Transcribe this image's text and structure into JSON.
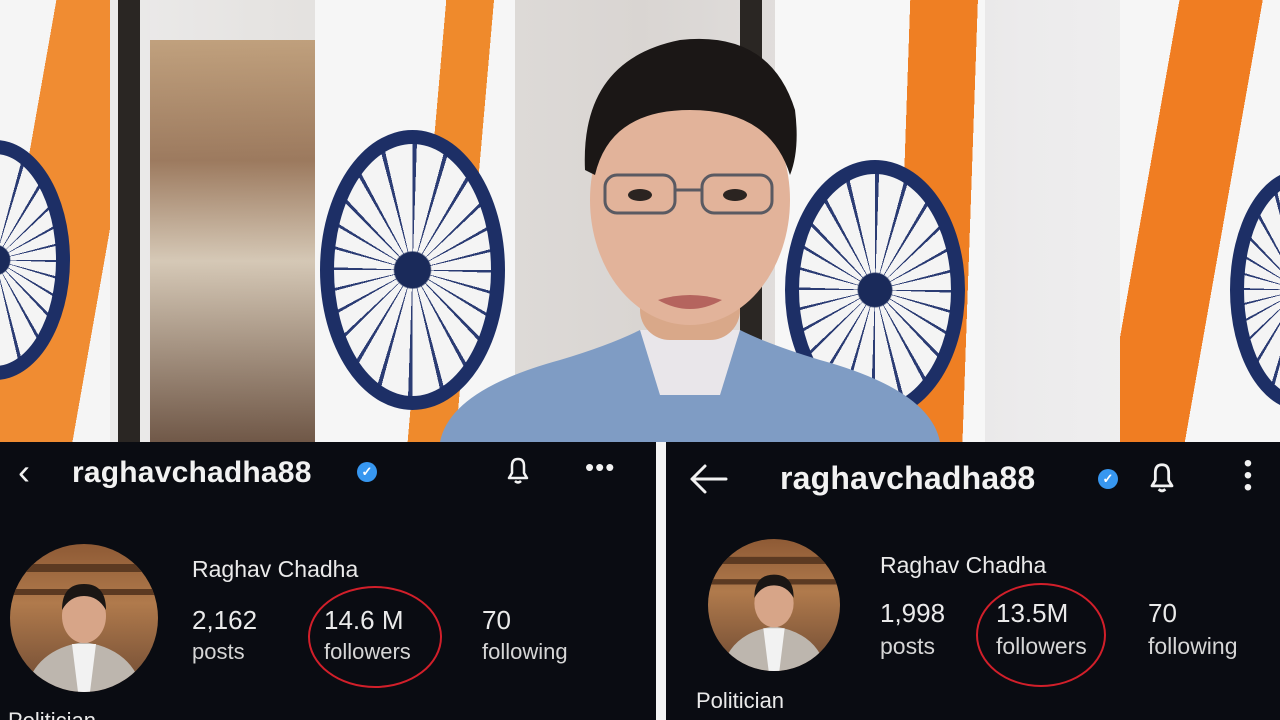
{
  "left_profile": {
    "username": "raghavchadha88",
    "display_name": "Raghav Chadha",
    "stats": [
      {
        "value": "2,162",
        "label": "posts"
      },
      {
        "value": "14.6 M",
        "label": "followers"
      },
      {
        "value": "70",
        "label": "following"
      }
    ],
    "category": "Politician",
    "icons": {
      "back": "chevron-left-icon",
      "notify": "bell-icon",
      "more": "more-horizontal-icon"
    }
  },
  "right_profile": {
    "username": "raghavchadha88",
    "display_name": "Raghav Chadha",
    "stats": [
      {
        "value": "1,998",
        "label": "posts"
      },
      {
        "value": "13.5M",
        "label": "followers"
      },
      {
        "value": "70",
        "label": "following"
      }
    ],
    "category": "Politician",
    "icons": {
      "back": "arrow-left-icon",
      "notify": "bell-icon",
      "more": "more-vertical-icon"
    }
  },
  "colors": {
    "verified": "#3797f0",
    "highlight_ring": "#d21f2a",
    "background": "#0a0c12"
  }
}
